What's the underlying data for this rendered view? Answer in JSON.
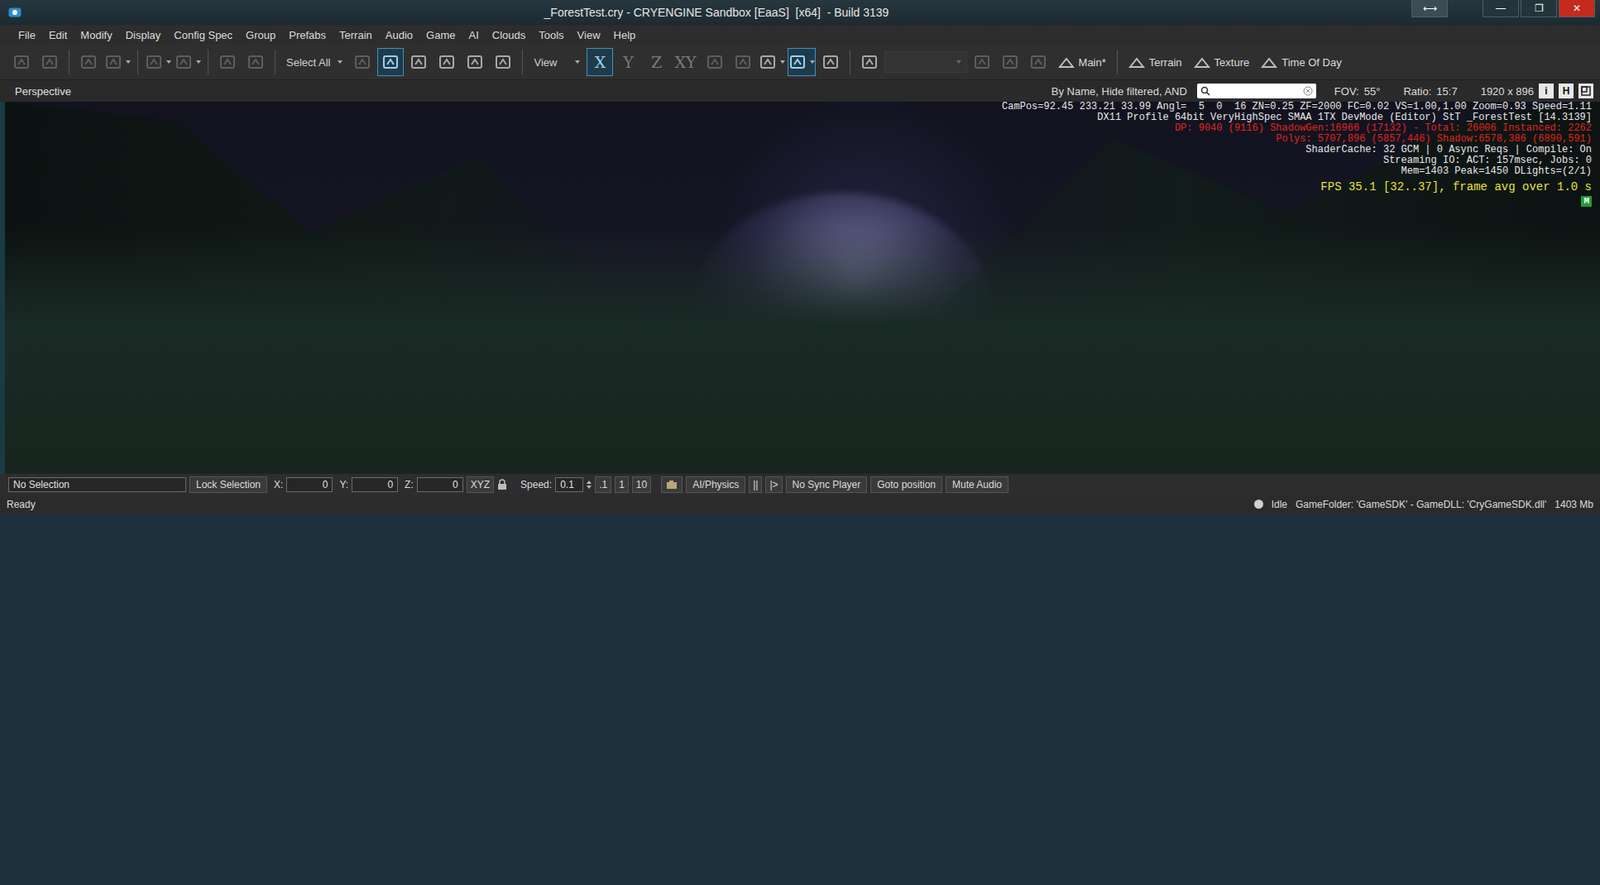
{
  "window": {
    "title": "_ForestTest.cry - CRYENGINE Sandbox [EaaS]  [x64]  - Build 3139",
    "controls": [
      {
        "glyph": "⟷",
        "color": "#3b4c55"
      },
      {
        "glyph": "—",
        "color": "#23343c"
      },
      {
        "glyph": "❐",
        "color": "#23343c"
      },
      {
        "glyph": "✕",
        "color": "#c42b1c"
      }
    ]
  },
  "menu": [
    "File",
    "Edit",
    "Modify",
    "Display",
    "Config Spec",
    "Group",
    "Prefabs",
    "Terrain",
    "Audio",
    "Game",
    "AI",
    "Clouds",
    "Tools",
    "View",
    "Help"
  ],
  "toolbar": [
    {
      "kind": "icon",
      "selected": false,
      "disabled": true,
      "menu": false
    },
    {
      "kind": "icon",
      "selected": false,
      "disabled": true,
      "menu": false
    },
    {
      "kind": "separator"
    },
    {
      "kind": "icon",
      "selected": false,
      "disabled": true,
      "menu": false
    },
    {
      "kind": "icon",
      "selected": false,
      "disabled": true,
      "menu": true
    },
    {
      "kind": "separator"
    },
    {
      "kind": "icon",
      "selected": false,
      "disabled": true,
      "menu": true
    },
    {
      "kind": "icon",
      "selected": false,
      "disabled": true,
      "menu": true
    },
    {
      "kind": "separator"
    },
    {
      "kind": "icon",
      "selected": false,
      "disabled": true,
      "menu": false
    },
    {
      "kind": "icon",
      "selected": false,
      "disabled": true,
      "menu": false
    },
    {
      "kind": "separator"
    },
    {
      "kind": "dropdown",
      "label": "Select All",
      "selected": false,
      "disabled": false
    },
    {
      "kind": "icon",
      "selected": false,
      "disabled": true,
      "menu": false
    },
    {
      "kind": "icon",
      "selected": true,
      "disabled": false,
      "menu": false
    },
    {
      "kind": "icon",
      "selected": false,
      "disabled": false,
      "menu": false
    },
    {
      "kind": "icon",
      "selected": false,
      "disabled": false,
      "menu": false
    },
    {
      "kind": "icon",
      "selected": false,
      "disabled": false,
      "menu": false
    },
    {
      "kind": "icon",
      "selected": false,
      "disabled": false,
      "menu": false
    },
    {
      "kind": "separator"
    },
    {
      "kind": "dropdown",
      "label": "View",
      "selected": false,
      "disabled": false
    },
    {
      "kind": "axis",
      "label": "X",
      "selected": true,
      "disabled": false
    },
    {
      "kind": "axis",
      "label": "Y",
      "selected": false,
      "disabled": false
    },
    {
      "kind": "axis",
      "label": "Z",
      "selected": false,
      "disabled": false
    },
    {
      "kind": "axis",
      "label": "XY",
      "selected": false,
      "disabled": false
    },
    {
      "kind": "icon",
      "selected": false,
      "disabled": true,
      "menu": false
    },
    {
      "kind": "icon",
      "selected": false,
      "disabled": true,
      "menu": false
    },
    {
      "kind": "icon",
      "selected": false,
      "disabled": false,
      "menu": true
    },
    {
      "kind": "icon",
      "selected": true,
      "disabled": false,
      "menu": true
    },
    {
      "kind": "icon",
      "selected": false,
      "disabled": false,
      "menu": false
    },
    {
      "kind": "separator"
    },
    {
      "kind": "icon",
      "selected": false,
      "disabled": false,
      "menu": false
    },
    {
      "kind": "dropdown",
      "label": "",
      "selected": false,
      "disabled": true
    },
    {
      "kind": "icon",
      "selected": false,
      "disabled": true,
      "menu": false
    },
    {
      "kind": "icon",
      "selected": false,
      "disabled": true,
      "menu": false
    },
    {
      "kind": "icon",
      "selected": false,
      "disabled": true,
      "menu": false
    },
    {
      "kind": "labeled",
      "label": "Main*",
      "selected": false,
      "disabled": false
    },
    {
      "kind": "separator"
    },
    {
      "kind": "labeled",
      "label": "Terrain",
      "selected": false,
      "disabled": false
    },
    {
      "kind": "labeled",
      "label": "Texture",
      "selected": false,
      "disabled": false
    },
    {
      "kind": "labeled",
      "label": "Time Of Day",
      "selected": false,
      "disabled": false
    }
  ],
  "viewport_header": {
    "view": "Perspective",
    "filter": "By Name, Hide filtered, AND",
    "search": "",
    "fov_label": "FOV:",
    "fov": "55°",
    "ratio_label": "Ratio:",
    "ratio": "15:7",
    "resolution": "1920 x 896",
    "buttons": [
      {
        "label": "i",
        "selected": false
      },
      {
        "label": "H",
        "selected": false
      }
    ]
  },
  "overlay": {
    "lines": [
      {
        "text": "CamPos=92.45 233.21 33.99 Angl=  5  0  16 ZN=0.25 ZF=2000 FC=0.02 VS=1.00,1.00 Zoom=0.93 Speed=1.11",
        "color": "#e8e8e8"
      },
      {
        "text": "DX11 Profile 64bit VeryHighSpec SMAA 1TX DevMode (Editor) StT _ForestTest [14.3139]",
        "color": "#e8e8e8"
      },
      {
        "text": "DP: 9040 (9116) ShadowGen:16966 (17132) - Total: 26006 Instanced: 2262",
        "color": "#e0241c"
      },
      {
        "text": "Polys: 5707,896 (5857,446) Shadow:6578,386 (6890,591)",
        "color": "#e0241c"
      },
      {
        "text": "ShaderCache: 32 GCM | 0 Async Reqs | Compile: On",
        "color": "#e8e8e8"
      },
      {
        "text": "Streaming IO: ACT: 157msec, Jobs: 0",
        "color": "#e8e8e8"
      },
      {
        "text": "Mem=1403 Peak=1450 DLights=(2/1)",
        "color": "#e8e8e8"
      }
    ],
    "fps": "FPS 35.1 [32..37], frame avg over 1.0 s",
    "badge": "M"
  },
  "bottom_bar": {
    "selection": "No Selection",
    "lock": "Lock Selection",
    "coords": [
      {
        "label": "X:",
        "value": "0"
      },
      {
        "label": "Y:",
        "value": "0"
      },
      {
        "label": "Z:",
        "value": "0"
      }
    ],
    "xyz": "XYZ",
    "speed_label": "Speed:",
    "speed": "0.1",
    "presets": [
      ".1",
      "1",
      "10"
    ],
    "ai_physics": "AI/Physics",
    "transport": [
      "||",
      "|>"
    ],
    "buttons": [
      "No Sync Player",
      "Goto position",
      "Mute Audio"
    ]
  },
  "status_bar": {
    "message": "Ready",
    "state": "Idle",
    "info": "GameFolder: 'GameSDK' - GameDLL: 'CryGameSDK.dll'",
    "memory": "1403 Mb"
  }
}
